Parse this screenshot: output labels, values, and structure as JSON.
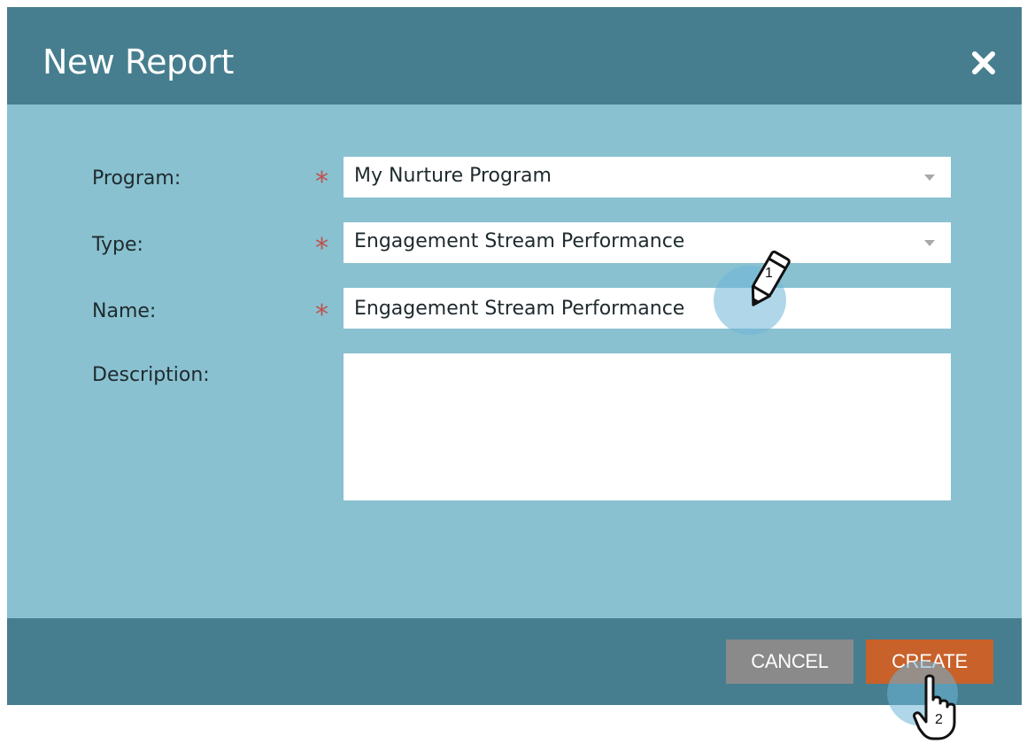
{
  "dialog": {
    "title": "New Report",
    "close_icon": "close-icon"
  },
  "form": {
    "program": {
      "label": "Program:",
      "required_mark": "*",
      "value": "My Nurture Program"
    },
    "type": {
      "label": "Type:",
      "required_mark": "*",
      "value": "Engagement Stream Performance"
    },
    "name": {
      "label": "Name:",
      "required_mark": "*",
      "value": "Engagement Stream Performance"
    },
    "description": {
      "label": "Description:",
      "value": ""
    }
  },
  "footer": {
    "cancel_label": "CANCEL",
    "create_label": "CREATE"
  },
  "annotations": {
    "step1": "1",
    "step2": "2",
    "step1_icon": "pencil-cursor-icon",
    "step2_icon": "hand-pointer-icon"
  },
  "colors": {
    "header": "#467e8f",
    "body": "#89c1d0",
    "required": "#c0504d",
    "cancel": "#8a8a8a",
    "create": "#c8612a"
  }
}
